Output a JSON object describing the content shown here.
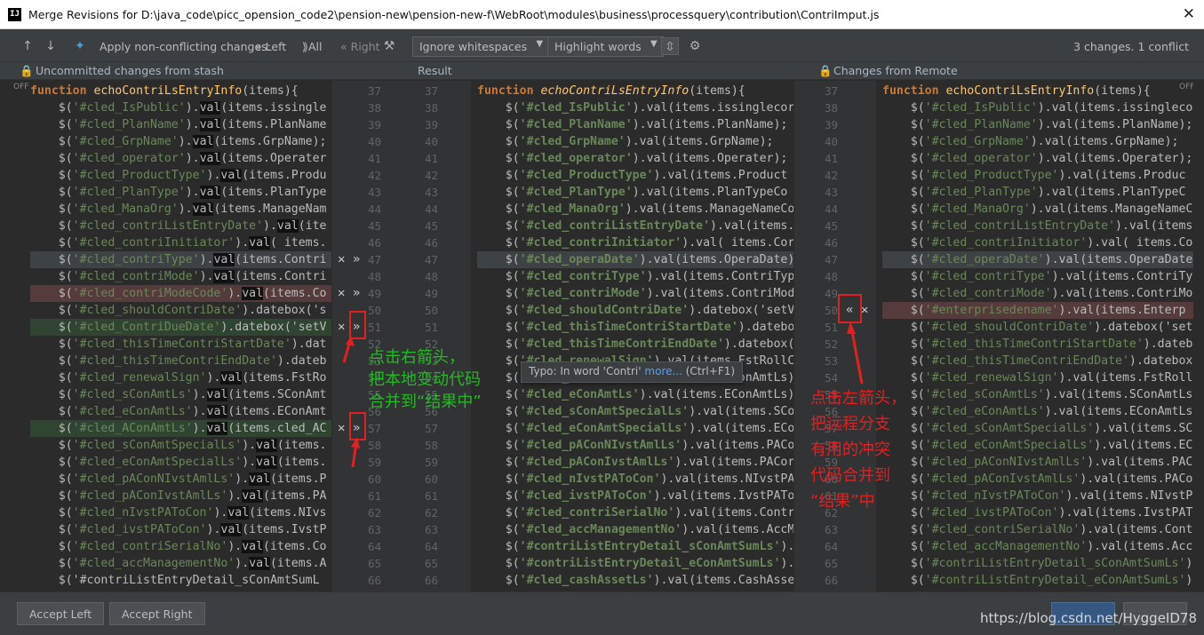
{
  "window": {
    "title": "Merge Revisions for D:\\java_code\\picc_opension_code2\\pension-new\\pension-new-f\\WebRoot\\modules\\business\\processquery\\contribution\\ContriImput.js",
    "app_icon": "IJ",
    "close_glyph": "✕"
  },
  "toolbar": {
    "apply_label": "Apply non-conflicting changes:",
    "left_label": "Left",
    "all_label": "All",
    "right_label": "Right",
    "whitespace_select": "Ignore whitespaces",
    "highlight_select": "Highlight words",
    "changes_summary": "3 changes. 1 conflict"
  },
  "headers": {
    "left": "Uncommitted changes from stash",
    "middle": "Result",
    "right": "Changes from Remote"
  },
  "gutters": {
    "left_numbers": [
      "37",
      "38",
      "39",
      "40",
      "41",
      "42",
      "43",
      "44",
      "45",
      "46",
      "47",
      "48",
      "49",
      "50",
      "51",
      "52",
      "53",
      "54",
      "55",
      "56",
      "57",
      "58",
      "59",
      "60",
      "61",
      "62",
      "63",
      "64",
      "65",
      "66"
    ],
    "center_numbers": [
      "37",
      "38",
      "39",
      "40",
      "41",
      "42",
      "43",
      "44",
      "45",
      "46",
      "47",
      "48",
      "49",
      "50",
      "51",
      "52",
      "53",
      "54",
      "55",
      "56",
      "57",
      "58",
      "59",
      "60",
      "61",
      "62",
      "63",
      "64",
      "65",
      "66"
    ],
    "right_numbers": [
      "37",
      "38",
      "39",
      "40",
      "41",
      "42",
      "43",
      "44",
      "45",
      "46",
      "47",
      "48",
      "49",
      "50",
      "51",
      "52",
      "53",
      "54",
      "55",
      "56",
      "57",
      "58",
      "59",
      "60",
      "61",
      "62",
      "63",
      "64",
      "65",
      "66"
    ]
  },
  "left_code": [
    "function echoContriLsEntryInfo(items){",
    "    $('#cled_IsPublic').val(items.issingle",
    "    $('#cled_PlanName').val(items.PlanName",
    "    $('#cled_GrpName').val(items.GrpName);",
    "    $('#cled_operator').val(items.Operater",
    "    $('#cled_ProductType').val(items.Produ",
    "    $('#cled_PlanType').val(items.PlanType",
    "    $('#cled_ManaOrg').val(items.ManageNam",
    "    $('#cled_contriListEntryDate').val(ite",
    "    $('#cled_contriInitiator').val( items.",
    "    $('#cled_contriType').val(items.Contri",
    "    $('#cled_contriMode').val(items.Contri",
    "    $('#cled_contriModeCode').val(items.Co",
    "    $('#cled_shouldContriDate').datebox('s",
    "    $('#cled_ContriDueDate').datebox('setV",
    "    $('#cled_thisTimeContriStartDate').dat",
    "    $('#cled_thisTimeContriEndDate').dateb",
    "    $('#cled_renewalSign').val(items.FstRo",
    "    $('#cled_sConAmtLs').val(items.SConAmt",
    "    $('#cled_eConAmtLs').val(items.EConAmt",
    "    $('#cled_AConAmtLs').val(items.cled_AC",
    "    $('#cled_sConAmtSpecialLs').val(items.",
    "    $('#cled_eConAmtSpecialLs').val(items.",
    "    $('#cled_pAConNIvstAmlLs').val(items.P",
    "    $('#cled_pAConIvstAmlLs').val(items.PA",
    "    $('#cled_nIvstPAToCon').val(items.NIvs",
    "    $('#cled_ivstPAToCon').val(items.IvstP",
    "    $('#cled_contriSerialNo').val(items.Co",
    "    $('#cled_accManagementNo').val(items.A",
    "    $('#contriListEntryDetail_sConAmtSumL"
  ],
  "middle_code": [
    "function echoContriLsEntryInfo(items){",
    "    $('#cled_IsPublic').val(items.issinglecor",
    "    $('#cled_PlanName').val(items.PlanName);",
    "    $('#cled_GrpName').val(items.GrpName);",
    "    $('#cled_operator').val(items.Operater);",
    "    $('#cled_ProductType').val(items.Product",
    "    $('#cled_PlanType').val(items.PlanTypeCo",
    "    $('#cled_ManaOrg').val(items.ManageNameCo",
    "    $('#cled_contriListEntryDate').val(items.",
    "    $('#cled_contriInitiator').val( items.Cor",
    "    $('#cled_operaDate').val(items.OperaDate)",
    "    $('#cled_contriType').val(items.ContriTyp",
    "    $('#cled_contriMode').val(items.ContriMod",
    "    $('#cled_shouldContriDate').datebox('setV",
    "    $('#cled_thisTimeContriStartDate').datebo",
    "    $('#cled_thisTimeContriEndDate').datebox(",
    "    $('#cled_renewalSign').val(items.FstRollC",
    "    $('#cled_sConAmtLs').val(items.SConAmtLs)",
    "    $('#cled_eConAmtLs').val(items.EConAmtLs)",
    "    $('#cled_sConAmtSpecialLs').val(items.SCo",
    "    $('#cled_eConAmtSpecialLs').val(items.ECo",
    "    $('#cled_pAConNIvstAmlLs').val(items.PACo",
    "    $('#cled_pAConIvstAmlLs').val(items.PACor",
    "    $('#cled_nIvstPAToCon').val(items.NIvstPA",
    "    $('#cled_ivstPAToCon').val(items.IvstPATo",
    "    $('#cled_contriSerialNo').val(items.Contr",
    "    $('#cled_accManagementNo').val(items.AccM",
    "    $('#contriListEntryDetail_sConAmtSumLs').",
    "    $('#contriListEntryDetail_eConAmtSumLs').",
    "    $('#cled_cashAssetLs').val(items.CashAsse"
  ],
  "right_code": [
    "function echoContriLsEntryInfo(items){",
    "    $('#cled_IsPublic').val(items.issinglecor",
    "    $('#cled_PlanName').val(items.PlanName);",
    "    $('#cled_GrpName').val(items.GrpName);",
    "    $('#cled_operator').val(items.Operater);",
    "    $('#cled_ProductType').val(items.Produc",
    "    $('#cled_PlanType').val(items.PlanTypeC",
    "    $('#cled_ManaOrg').val(items.ManageNameC",
    "    $('#cled_contriListEntryDate').val(items",
    "    $('#cled_contriInitiator').val( items.Cor",
    "    $('#cled_operaDate').val(items.OperaDate",
    "    $('#cled_contriType').val(items.ContriTy",
    "    $('#cled_contriMode').val(items.ContriMo",
    "    $('#enterprisedename').val(items.Enterp",
    "    $('#cled_shouldContriDate').datebox('set",
    "    $('#cled_thisTimeContriStartDate').dateb",
    "    $('#cled_thisTimeContriEndDate').datebox",
    "    $('#cled_renewalSign').val(items.FstRoll",
    "    $('#cled_sConAmtLs').val(items.SConAmtLs",
    "    $('#cled_eConAmtLs').val(items.EConAmtLs",
    "    $('#cled_sConAmtSpecialLs').val(items.SC",
    "    $('#cled_eConAmtSpecialLs').val(items.EC",
    "    $('#cled_pAConNIvstAmlLs').val(items.PAC",
    "    $('#cled_pAConIvstAmlLs').val(items.PACo",
    "    $('#cled_nIvstPAToCon').val(items.NIvstP",
    "    $('#cled_ivstPAToCon').val(items.IvstPAT",
    "    $('#cled_contriSerialNo').val(items.Cont",
    "    $('#cled_accManagementNo').val(items.Acc",
    "    $('#contriListEntryDetail_sConAmtSumLs')",
    "    $('#contriListEntryDetail_eConAmtSumLs')"
  ],
  "tooltip": {
    "text": "Typo: In word 'Contri'",
    "more": "more...",
    "shortcut": "(Ctrl+F1)"
  },
  "annotations": {
    "left_note": [
      "点击右箭头，",
      "把本地变动代码",
      "合并到“结果中”"
    ],
    "right_note": [
      "点击左箭头，",
      "把远程分支",
      "有用的冲突",
      "代码合并到",
      "“结果”中"
    ],
    "left_note_color": "#22bb22",
    "right_note_color": "#e32020"
  },
  "markers": {
    "off_left": "OFF",
    "off_right": "OFF"
  },
  "footer": {
    "accept_left": "Accept Left",
    "accept_right": "Accept Right",
    "watermark": "https://blog.csdn.net/HyggeID78"
  },
  "colors": {
    "keyword": "#cc7832",
    "string": "#6a8759",
    "function": "#ffc66d",
    "deleted_bg": "#553b3b",
    "added_bg": "#2f4532"
  }
}
